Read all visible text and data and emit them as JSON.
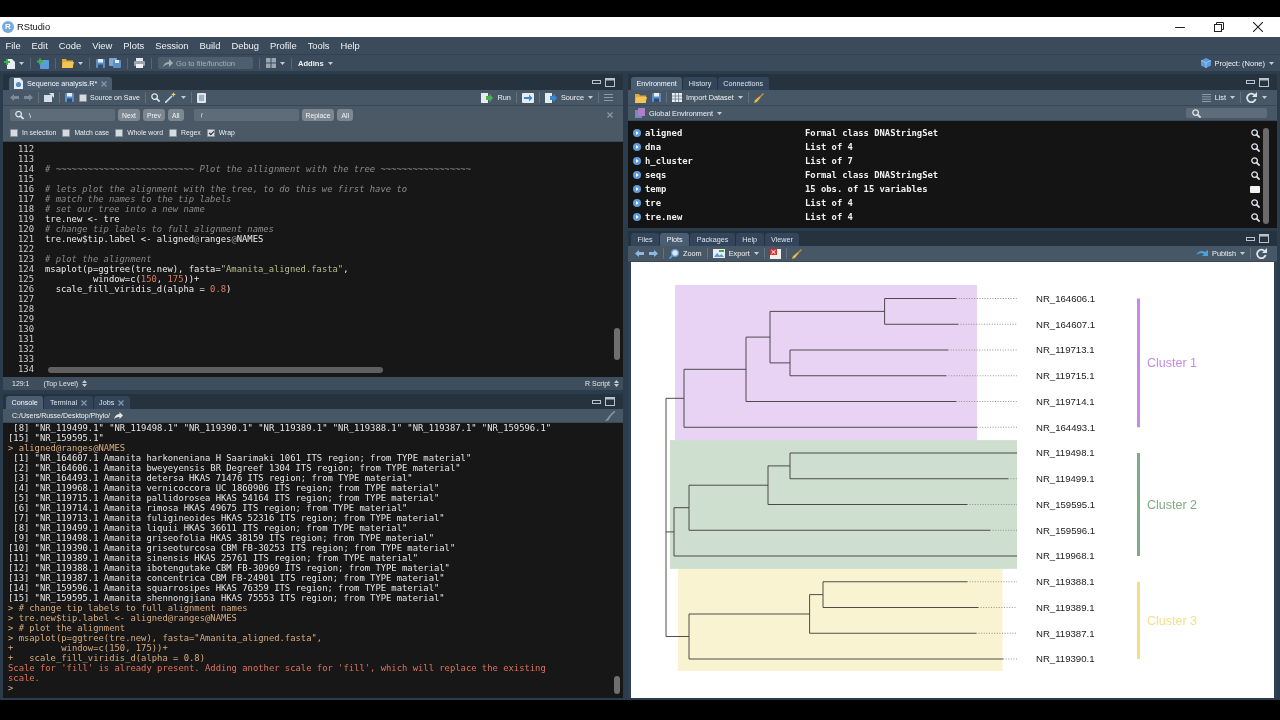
{
  "window": {
    "logo": "R",
    "title": "RStudio"
  },
  "menu": [
    "File",
    "Edit",
    "Code",
    "View",
    "Plots",
    "Session",
    "Build",
    "Debug",
    "Profile",
    "Tools",
    "Help"
  ],
  "toolbar": {
    "goto_placeholder": "Go to file/function",
    "addins": "Addins",
    "project": "Project: (None)"
  },
  "editor": {
    "tabs": [
      {
        "label": "Sequence analysis.R*",
        "selected": true,
        "closable": true
      }
    ],
    "source_on_save": {
      "label": "Source on Save",
      "checked": false
    },
    "run": "Run",
    "source": "Source",
    "find": {
      "search": "\\",
      "next": "Next",
      "prev": "Prev",
      "find_all": "All",
      "replace": "/",
      "replace_button": "Replace",
      "replace_all": "All"
    },
    "options": [
      {
        "label": "In selection",
        "checked": false
      },
      {
        "label": "Match case",
        "checked": false
      },
      {
        "label": "Whole word",
        "checked": false
      },
      {
        "label": "Regex",
        "checked": false
      },
      {
        "label": "Wrap",
        "checked": true
      }
    ],
    "lines": [
      {
        "number": "112"
      },
      {
        "number": "113"
      },
      {
        "number": "114",
        "tokens": [
          {
            "kind": "comment",
            "text": "# ~~~~~~~~~~~~~~~~~~~~~~~~~~ Plot the allignment with the tree ~~~~~~~~~~~~~~~~~"
          }
        ]
      },
      {
        "number": "115"
      },
      {
        "number": "116",
        "tokens": [
          {
            "kind": "comment",
            "text": "# lets plot the alignment with the tree, to do this we first have to"
          }
        ]
      },
      {
        "number": "117",
        "tokens": [
          {
            "kind": "comment",
            "text": "# match the names to the tip labels"
          }
        ]
      },
      {
        "number": "118",
        "tokens": [
          {
            "kind": "comment",
            "text": "# set our tree into a new name"
          }
        ]
      },
      {
        "number": "119",
        "tokens": [
          {
            "kind": "plain",
            "text": "tre.new <- tre"
          }
        ]
      },
      {
        "number": "120",
        "tokens": [
          {
            "kind": "comment",
            "text": "# change tip labels to full alignment names"
          }
        ]
      },
      {
        "number": "121",
        "tokens": [
          {
            "kind": "plain",
            "text": "tre.new$tip.label <- aligned"
          },
          {
            "kind": "punct",
            "text": "@"
          },
          {
            "kind": "plain",
            "text": "ranges"
          },
          {
            "kind": "punct",
            "text": "@"
          },
          {
            "kind": "plain",
            "text": "NAMES"
          }
        ]
      },
      {
        "number": "122"
      },
      {
        "number": "123",
        "tokens": [
          {
            "kind": "comment",
            "text": "# plot the alignment"
          }
        ]
      },
      {
        "number": "124",
        "tokens": [
          {
            "kind": "plain",
            "text": "msaplot(p=ggtree(tre.new), fasta="
          },
          {
            "kind": "string",
            "text": "\"Amanita_aligned.fasta\""
          },
          {
            "kind": "plain",
            "text": ","
          }
        ]
      },
      {
        "number": "125",
        "tokens": [
          {
            "kind": "plain",
            "text": "         window=c("
          },
          {
            "kind": "number",
            "text": "150"
          },
          {
            "kind": "plain",
            "text": ", "
          },
          {
            "kind": "number",
            "text": "175"
          },
          {
            "kind": "plain",
            "text": "))+"
          }
        ]
      },
      {
        "number": "126",
        "tokens": [
          {
            "kind": "plain",
            "text": "  scale_fill_viridis_d(alpha = "
          },
          {
            "kind": "number",
            "text": "0.8"
          },
          {
            "kind": "plain",
            "text": ")"
          }
        ]
      },
      {
        "number": "127"
      },
      {
        "number": "128"
      },
      {
        "number": "129"
      },
      {
        "number": "130"
      },
      {
        "number": "131"
      },
      {
        "number": "132"
      },
      {
        "number": "133"
      },
      {
        "number": "134"
      }
    ],
    "status": {
      "position": "129:1",
      "scope": "(Top Level)",
      "file_type": "R Script"
    }
  },
  "console": {
    "tabs": [
      {
        "label": "Console",
        "selected": true,
        "closable": false
      },
      {
        "label": "Terminal",
        "selected": false,
        "closable": true
      },
      {
        "label": "Jobs",
        "selected": false,
        "closable": true
      }
    ],
    "path": "C:/Users/Russe/Desktop/Phylo/",
    "lines": [
      {
        "kind": "output",
        "text": " [8] \"NR_119499.1\" \"NR_119498.1\" \"NR_119390.1\" \"NR_119389.1\" \"NR_119388.1\" \"NR_119387.1\" \"NR_159596.1\""
      },
      {
        "kind": "output",
        "text": "[15] \"NR_159595.1\""
      },
      {
        "kind": "input",
        "text": "> aligned@ranges@NAMES"
      },
      {
        "kind": "output",
        "text": " [1] \"NR_164607.1 Amanita harkoneniana H Saarimaki 1061 ITS region; from TYPE material\""
      },
      {
        "kind": "output",
        "text": " [2] \"NR_164606.1 Amanita bweyeyensis BR Degreef 1304 ITS region; from TYPE material\""
      },
      {
        "kind": "output",
        "text": " [3] \"NR_164493.1 Amanita detersa HKAS 71476 ITS region; from TYPE material\""
      },
      {
        "kind": "output",
        "text": " [4] \"NR_119968.1 Amanita vernicoccora UC 1860906 ITS region; from TYPE material\""
      },
      {
        "kind": "output",
        "text": " [5] \"NR_119715.1 Amanita pallidorosea HKAS 54164 ITS region; from TYPE material\""
      },
      {
        "kind": "output",
        "text": " [6] \"NR_119714.1 Amanita rimosa HKAS 49675 ITS region; from TYPE material\""
      },
      {
        "kind": "output",
        "text": " [7] \"NR_119713.1 Amanita fuligineoides HKAS 52316 ITS region; from TYPE material\""
      },
      {
        "kind": "output",
        "text": " [8] \"NR_119499.1 Amanita liquii HKAS 36611 ITS region; from TYPE material\""
      },
      {
        "kind": "output",
        "text": " [9] \"NR_119498.1 Amanita griseofolia HKAS 38159 ITS region; from TYPE material\""
      },
      {
        "kind": "output",
        "text": "[10] \"NR_119390.1 Amanita griseoturcosa CBM FB-30253 ITS region; from TYPE material\""
      },
      {
        "kind": "output",
        "text": "[11] \"NR_119389.1 Amanita sinensis HKAS 25761 ITS region; from TYPE material\""
      },
      {
        "kind": "output",
        "text": "[12] \"NR_119388.1 Amanita ibotengutake CBM FB-30969 ITS region; from TYPE material\""
      },
      {
        "kind": "output",
        "text": "[13] \"NR_119387.1 Amanita concentrica CBM FB-24901 ITS region; from TYPE material\""
      },
      {
        "kind": "output",
        "text": "[14] \"NR_159596.1 Amanita squarrosipes HKAS 76359 ITS region; from TYPE material\""
      },
      {
        "kind": "output",
        "text": "[15] \"NR_159595.1 Amanita shennongjiana HKAS 75553 ITS region; from TYPE material\""
      },
      {
        "kind": "input",
        "text": "> # change tip labels to full alignment names"
      },
      {
        "kind": "input",
        "text": "> tre.new$tip.label <- aligned@ranges@NAMES"
      },
      {
        "kind": "input",
        "text": "> # plot the alignment"
      },
      {
        "kind": "input",
        "text": "> msaplot(p=ggtree(tre.new), fasta=\"Amanita_aligned.fasta\","
      },
      {
        "kind": "input",
        "text": "+         window=c(150, 175))+"
      },
      {
        "kind": "input",
        "text": "+   scale_fill_viridis_d(alpha = 0.8)"
      },
      {
        "kind": "message",
        "text": "Scale for 'fill' is already present. Adding another scale for 'fill', which will replace the existing"
      },
      {
        "kind": "message",
        "text": "scale."
      },
      {
        "kind": "input",
        "text": ">"
      }
    ]
  },
  "environment": {
    "tabs": [
      {
        "label": "Environment",
        "selected": true
      },
      {
        "label": "History",
        "selected": false
      },
      {
        "label": "Connections",
        "selected": false
      }
    ],
    "import": "Import Dataset",
    "view": "List",
    "scope": "Global Environment",
    "rows": [
      {
        "name": "aligned",
        "value": "Formal class DNAStringSet",
        "kind": "object"
      },
      {
        "name": "dna",
        "value": "List of 4",
        "kind": "object"
      },
      {
        "name": "h_cluster",
        "value": "List of 7",
        "kind": "object"
      },
      {
        "name": "seqs",
        "value": "Formal class DNAStringSet",
        "kind": "object"
      },
      {
        "name": "temp",
        "value": "15 obs. of 15 variables",
        "kind": "data"
      },
      {
        "name": "tre",
        "value": "List of 4",
        "kind": "object"
      },
      {
        "name": "tre.new",
        "value": "List of 4",
        "kind": "object"
      }
    ]
  },
  "plots": {
    "tabs": [
      {
        "label": "Files",
        "selected": false
      },
      {
        "label": "Plots",
        "selected": true
      },
      {
        "label": "Packages",
        "selected": false
      },
      {
        "label": "Help",
        "selected": false
      },
      {
        "label": "Viewer",
        "selected": false
      }
    ],
    "zoom": "Zoom",
    "export": "Export",
    "publish": "Publish",
    "clusters": [
      {
        "label": "Cluster 1",
        "color": "#c58be6",
        "tips": [
          "NR_164606.1",
          "NR_164607.1",
          "NR_119713.1",
          "NR_119715.1",
          "NR_119714.1",
          "NR_164493.1"
        ]
      },
      {
        "label": "Cluster 2",
        "color": "#80ab80",
        "tips": [
          "NR_119498.1",
          "NR_119499.1",
          "NR_159595.1",
          "NR_159596.1",
          "NR_119968.1"
        ]
      },
      {
        "label": "Cluster 3",
        "color": "#f3df86",
        "tips": [
          "NR_119388.1",
          "NR_119389.1",
          "NR_119387.1",
          "NR_119390.1"
        ]
      }
    ]
  }
}
